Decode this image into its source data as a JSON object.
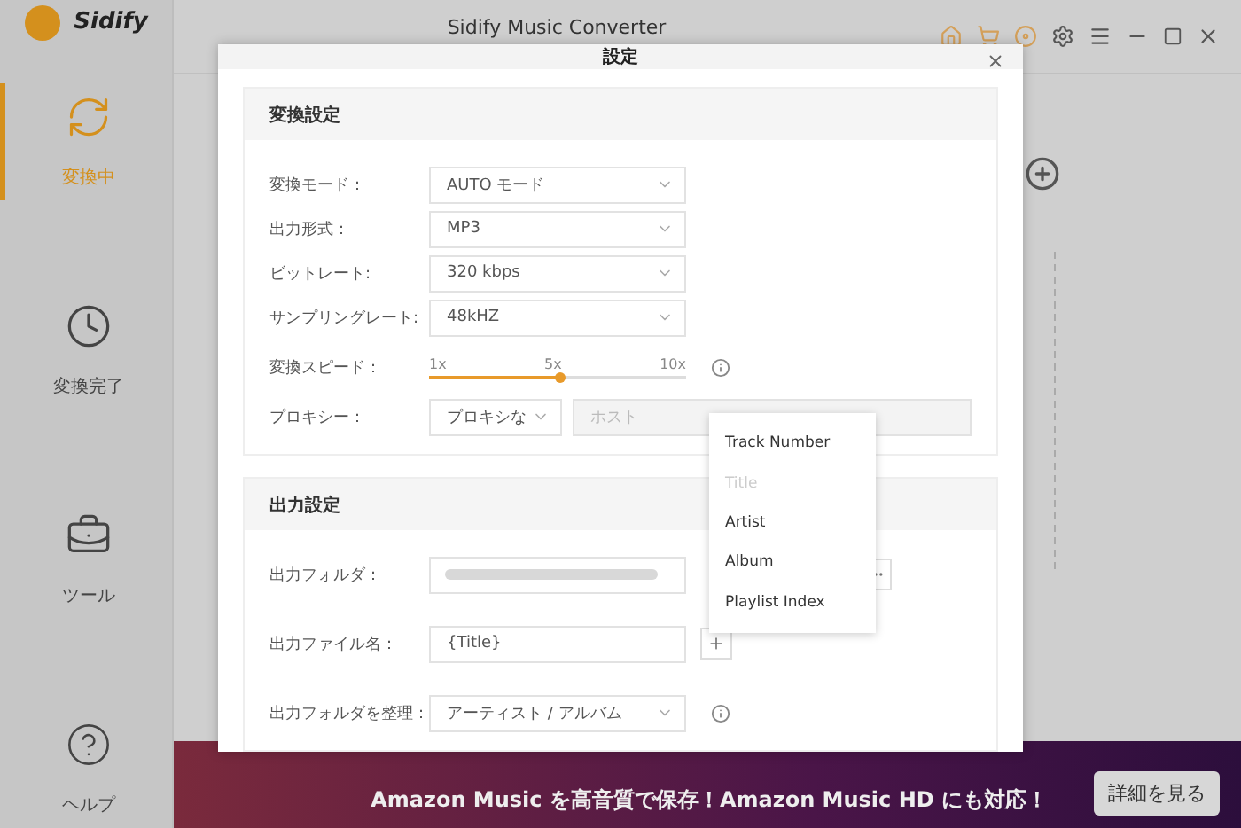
{
  "app": {
    "logo_text": "Sidify",
    "title": "Sidify Music Converter"
  },
  "nav": [
    {
      "label": "変換中",
      "kind": "converting",
      "selected": true
    },
    {
      "label": "変換完了",
      "kind": "clock",
      "selected": false
    },
    {
      "label": "ツール",
      "kind": "toolbox",
      "selected": false
    },
    {
      "label": "ヘルプ",
      "kind": "help",
      "selected": false
    }
  ],
  "dialog": {
    "title": "設定",
    "sections": [
      {
        "title": "変換設定",
        "rows": [
          {
            "kind": "select",
            "label": "変換モード：",
            "value": "AUTO モード"
          },
          {
            "kind": "select",
            "label": "出力形式：",
            "value": "MP3"
          },
          {
            "kind": "select",
            "label": "ビットレート:",
            "value": "320 kbps"
          },
          {
            "kind": "select",
            "label": "サンプリングレート:",
            "value": "48kHZ"
          },
          {
            "kind": "slider",
            "label": "変換スピード：",
            "ticks": [
              "1x",
              "5x",
              "10x"
            ],
            "level": 0.51
          },
          {
            "kind": "proxy",
            "label": "プロキシー：",
            "value": "プロキシな",
            "placeholder": "ホスト"
          }
        ]
      },
      {
        "title": "出力設定",
        "rows": [
          {
            "kind": "folder",
            "label": "出力フォルダ："
          },
          {
            "kind": "text",
            "label": "出力ファイル名：",
            "value": "{Title}"
          },
          {
            "kind": "organize",
            "label": "出力フォルダを整理：",
            "value": "アーティスト / アルバム"
          }
        ]
      }
    ]
  },
  "menu": [
    {
      "label": "Track Number",
      "disabled": false
    },
    {
      "label": "Title",
      "disabled": true
    },
    {
      "label": "Artist",
      "disabled": false
    },
    {
      "label": "Album",
      "disabled": false
    },
    {
      "label": "Playlist Index",
      "disabled": false
    }
  ],
  "banner": {
    "text": "Amazon Music を高音質で保存！Amazon Music HD にも対応！",
    "button": "詳細を見る"
  }
}
